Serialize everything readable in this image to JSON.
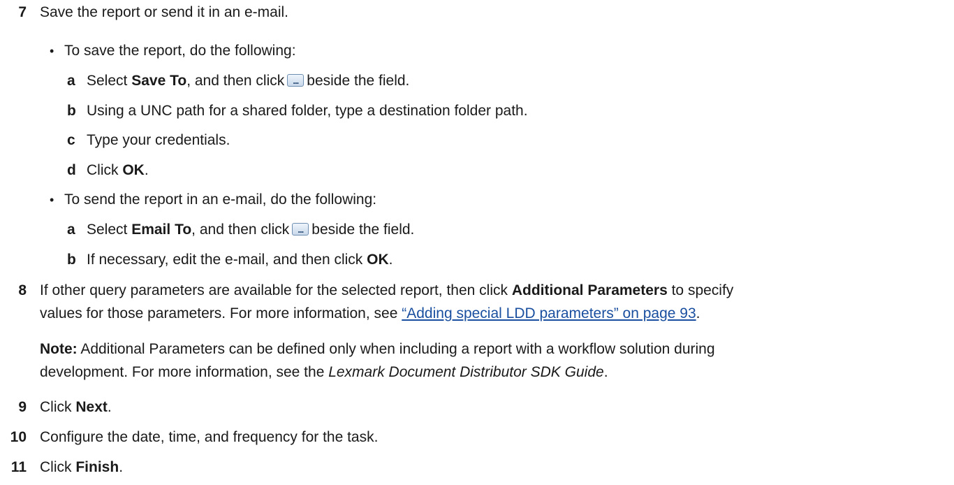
{
  "steps": {
    "s7": {
      "num": "7",
      "text": "Save the report or send it in an e-mail."
    },
    "save_bullet": "To save the report, do the following:",
    "save_a": {
      "letter": "a",
      "pre": "Select ",
      "bold": "Save To",
      "mid": ", and then click",
      "post": "beside the field."
    },
    "save_b": {
      "letter": "b",
      "text": "Using a UNC path for a shared folder, type a destination folder path."
    },
    "save_c": {
      "letter": "c",
      "text": "Type your credentials."
    },
    "save_d": {
      "letter": "d",
      "pre": "Click ",
      "bold": "OK",
      "post": "."
    },
    "email_bullet": "To send the report in an e-mail, do the following:",
    "email_a": {
      "letter": "a",
      "pre": "Select ",
      "bold": "Email To",
      "mid": ", and then click",
      "post": "beside the field."
    },
    "email_b": {
      "letter": "b",
      "pre": "If necessary, edit the e-mail, and then click ",
      "bold": "OK",
      "post": "."
    },
    "s8": {
      "num": "8",
      "line1_pre": "If other query parameters are available for the selected report, then click ",
      "line1_bold": "Additional Parameters",
      "line1_post": " to specify",
      "line2_pre": "values for those parameters. For more information, see ",
      "line2_link": "“Adding special LDD parameters” on page 93",
      "line2_post": "."
    },
    "note": {
      "label": "Note:",
      "line1": " Additional Parameters can be defined only when including a report with a workflow solution during",
      "line2_pre": "development. For more information, see the ",
      "line2_italic": "Lexmark Document Distributor SDK Guide",
      "line2_post": "."
    },
    "s9": {
      "num": "9",
      "pre": "Click ",
      "bold": "Next",
      "post": "."
    },
    "s10": {
      "num": "10",
      "text": "Configure the date, time, and frequency for the task."
    },
    "s11": {
      "num": "11",
      "pre": "Click ",
      "bold": "Finish",
      "post": "."
    }
  },
  "icons": {
    "browse": "ellipsis-browse-button-icon"
  },
  "colors": {
    "link": "#1a4fa0",
    "text": "#1a1a1a"
  }
}
